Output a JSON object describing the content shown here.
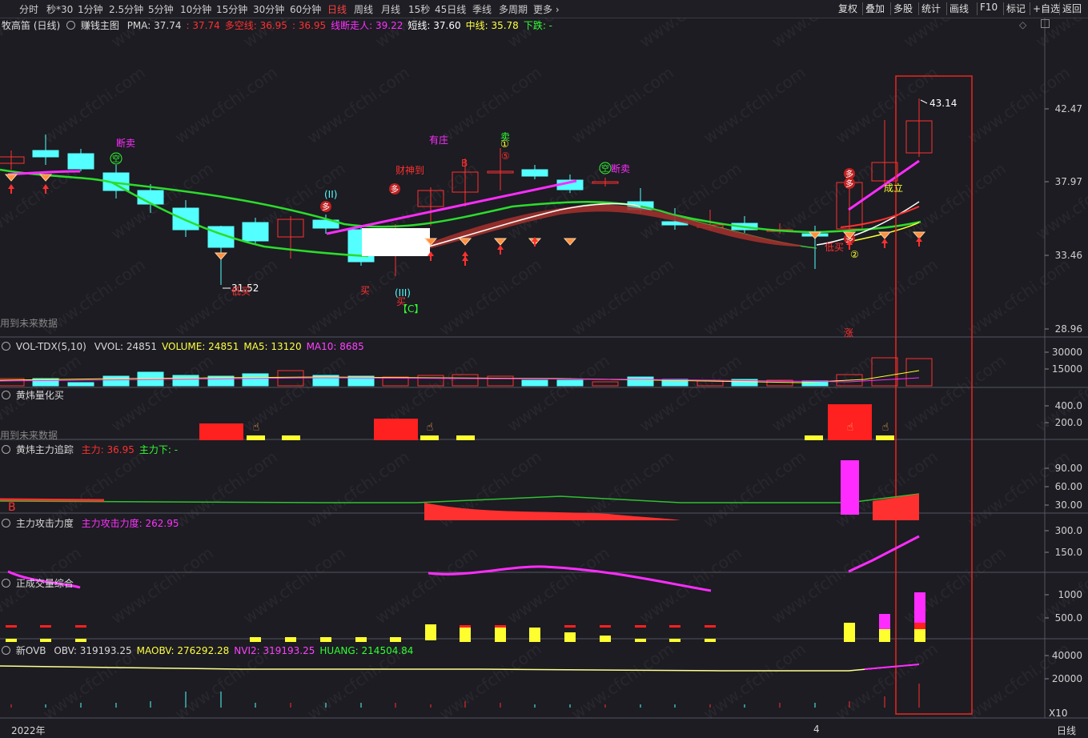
{
  "toolbar": {
    "periods": [
      "分时",
      "秒*30",
      "1分钟",
      "2.5分钟",
      "5分钟",
      "10分钟",
      "15分钟",
      "30分钟",
      "60分钟",
      "日线",
      "周线",
      "月线",
      "15秒",
      "45日线",
      "季线",
      "多周期",
      "更多 ›"
    ],
    "active_period": "日线",
    "right_buttons": [
      "复权",
      "叠加",
      "多股",
      "统计",
      "画线",
      "F10",
      "标记",
      "+自选",
      "返回"
    ]
  },
  "main_panel": {
    "stock_name": "牧高笛 (日线)",
    "indicator_name": "赚钱主图",
    "legend": [
      {
        "text": "PMA: 37.74",
        "color": "#d8d8d8"
      },
      {
        "text": ": 37.74",
        "color": "#ff3030"
      },
      {
        "text": "多空线: 36.95",
        "color": "#ff3030"
      },
      {
        "text": ": 36.95",
        "color": "#ff3030"
      },
      {
        "text": "线断走人: 39.22",
        "color": "#ff30ff"
      },
      {
        "text": "短线: 37.60",
        "color": "#ffffff"
      },
      {
        "text": "中线: 35.78",
        "color": "#ffff40"
      },
      {
        "text": "下跌: -",
        "color": "#30ff30"
      }
    ],
    "y_ticks": [
      "42.47",
      "37.97",
      "33.46",
      "28.96"
    ],
    "high_label": "43.14",
    "low_label": "31.52",
    "future_data_note": "用到未来数据",
    "annotations": {
      "sell_1": "断卖",
      "zhuang": "有庄",
      "caishen": "财神到",
      "buy_1": "买",
      "buy_2": "买",
      "wave_2": "(II)",
      "wave_3": "(III)",
      "wave_c": "【C】",
      "wave_b": "B",
      "sell_2": "卖",
      "circ_1": "①",
      "circ_5": "⑤",
      "kong_1": "空",
      "kong_2": "空",
      "sell_3": "断卖",
      "chengli": "成立",
      "dimai_1": "低买",
      "dimai_2": "低买",
      "circ_2": "②",
      "zhang": "涨",
      "duo": "多"
    }
  },
  "vol_panel": {
    "name": "VOL-TDX(5,10)",
    "legend": [
      {
        "text": "VVOL: 24851",
        "color": "#d8d8d8"
      },
      {
        "text": "VOLUME: 24851",
        "color": "#ffff40"
      },
      {
        "text": "MA5: 13120",
        "color": "#ffff40"
      },
      {
        "text": "MA10: 8685",
        "color": "#ff40ff"
      }
    ],
    "y_ticks": [
      "30000",
      "15000"
    ]
  },
  "quant_panel": {
    "name": "黄炜量化买",
    "future_data_note": "用到未来数据",
    "y_ticks": [
      "400.0",
      "200.0"
    ]
  },
  "track_panel": {
    "name": "黄炜主力追踪",
    "legend": [
      {
        "text": "主力: 36.95",
        "color": "#ff3030"
      },
      {
        "text": "主力下: -",
        "color": "#30ff30"
      }
    ],
    "y_ticks": [
      "90.00",
      "60.00",
      "30.00"
    ],
    "b_label": "B"
  },
  "attack_panel": {
    "name": "主力攻击力度",
    "legend": [
      {
        "text": "主力攻击力度: 262.95",
        "color": "#ff30ff"
      }
    ],
    "y_ticks": [
      "300.0",
      "150.0"
    ]
  },
  "zc_panel": {
    "name": "正成交量综合",
    "y_ticks": [
      "1000",
      "500.0"
    ]
  },
  "obv_panel": {
    "name": "新OVB",
    "legend": [
      {
        "text": "OBV: 319193.25",
        "color": "#d8d8d8"
      },
      {
        "text": "MAOBV: 276292.28",
        "color": "#ffff40"
      },
      {
        "text": "NVI2: 319193.25",
        "color": "#ff40ff"
      },
      {
        "text": "HUANG: 214504.84",
        "color": "#30ff30"
      }
    ],
    "y_ticks": [
      "40000",
      "20000"
    ],
    "x10_label": "X10"
  },
  "x_axis": {
    "year_label": "2022年",
    "month_label": "4",
    "period_label": "日线"
  },
  "watermark": "www.cfchi.com",
  "colors": {
    "up": "#ff3030",
    "down": "#54ffff",
    "pink": "#ff2cff",
    "green_line": "#2cdc2c",
    "yellow": "#ffff30",
    "highlight_box": "#e8261f",
    "bg": "#1c1c22"
  }
}
